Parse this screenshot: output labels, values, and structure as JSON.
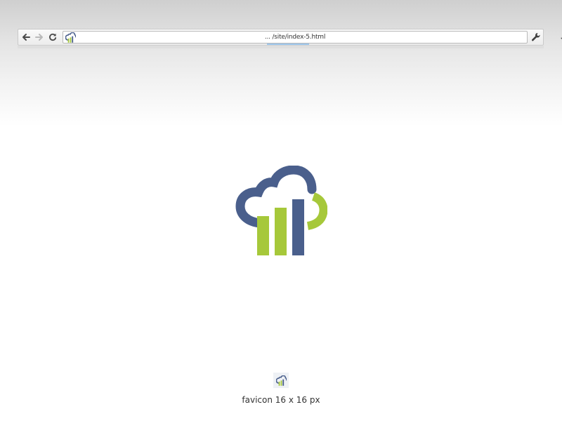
{
  "browser": {
    "url": "... /site/index-5.html",
    "icons": {
      "back": "arrow-left-icon",
      "forward": "arrow-right-icon",
      "reload": "reload-icon",
      "bookmark": "star-icon",
      "settings": "wrench-icon"
    }
  },
  "logo": {
    "colors": {
      "blue": "#4a5f8c",
      "green": "#a6c83a"
    }
  },
  "favicon": {
    "caption": "favicon 16 x 16 px"
  }
}
